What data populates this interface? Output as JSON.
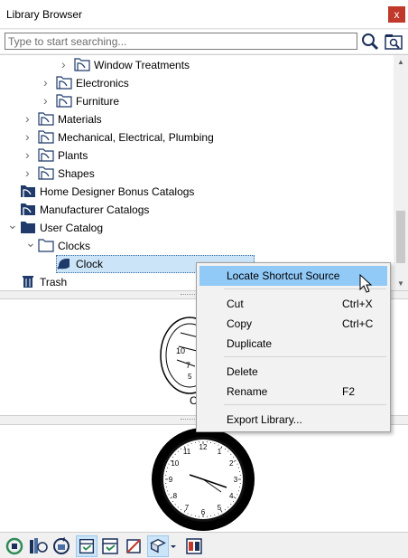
{
  "window": {
    "title": "Library Browser",
    "close_glyph": "x"
  },
  "search": {
    "placeholder": "Type to start searching..."
  },
  "tree": {
    "items": [
      {
        "label": "Window Treatments",
        "level": 3,
        "expandable": true
      },
      {
        "label": "Electronics",
        "level": 2,
        "expandable": true
      },
      {
        "label": "Furniture",
        "level": 2,
        "expandable": true
      },
      {
        "label": "Materials",
        "level": 1,
        "expandable": true
      },
      {
        "label": "Mechanical, Electrical, Plumbing",
        "level": 1,
        "expandable": true
      },
      {
        "label": "Plants",
        "level": 1,
        "expandable": true
      },
      {
        "label": "Shapes",
        "level": 1,
        "expandable": true
      },
      {
        "label": "Home Designer Bonus Catalogs",
        "level": 0,
        "expandable": false
      },
      {
        "label": "Manufacturer Catalogs",
        "level": 0,
        "expandable": false
      },
      {
        "label": "User Catalog",
        "level": 0,
        "expandable": true,
        "expanded": true
      },
      {
        "label": "Clocks",
        "level": 1,
        "expandable": true,
        "expanded": true
      },
      {
        "label": "Clock",
        "level": 2,
        "expandable": false,
        "selected": true
      },
      {
        "label": "Trash",
        "level": 0,
        "expandable": false
      }
    ]
  },
  "preview": {
    "clock_numbers": [
      "12",
      "1",
      "2",
      "3",
      "4",
      "5",
      "6",
      "7",
      "8",
      "9",
      "10",
      "11"
    ]
  },
  "context_menu": {
    "items": [
      {
        "label": "Locate Shortcut Source",
        "shortcut": "",
        "highlighted": true
      },
      {
        "label": "Cut",
        "shortcut": "Ctrl+X"
      },
      {
        "label": "Copy",
        "shortcut": "Ctrl+C"
      },
      {
        "label": "Duplicate",
        "shortcut": ""
      },
      {
        "label": "Delete",
        "shortcut": ""
      },
      {
        "label": "Rename",
        "shortcut": "F2"
      },
      {
        "label": "Export Library...",
        "shortcut": ""
      }
    ]
  },
  "colors": {
    "selection": "#cce4f7",
    "menu_highlight": "#91c9f7",
    "close": "#c0392b",
    "folder_dark": "#1f3a6b"
  }
}
